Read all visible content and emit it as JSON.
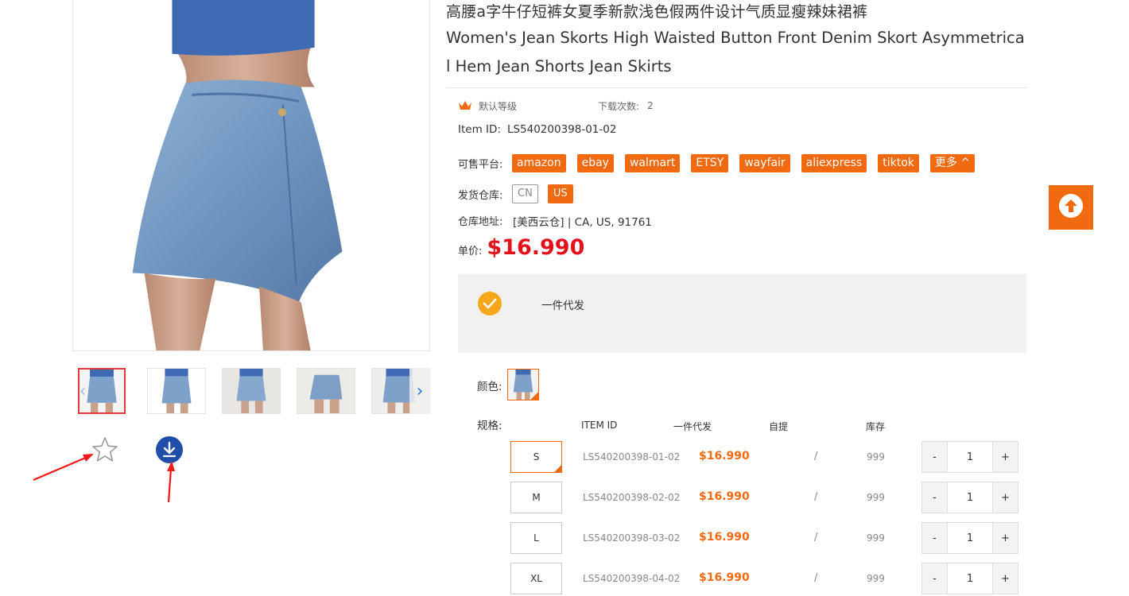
{
  "product": {
    "title_cn": "高腰a字牛仔短裤女夏季新款浅色假两件设计气质显瘦辣妹裙裤",
    "title_en": "Women's Jean Skorts High Waisted Button Front Denim Skort Asymmetrical Hem Jean Shorts Jean Skirts",
    "level": "默认等级",
    "download_count_label": "下载次数:",
    "download_count": "2",
    "item_id_label": "Item ID:",
    "item_id": "LS540200398-01-02",
    "platforms_label": "可售平台:",
    "platforms": [
      "amazon",
      "ebay",
      "walmart",
      "ETSY",
      "wayfair",
      "aliexpress",
      "tiktok"
    ],
    "more_label": "更多",
    "warehouse_label": "发货仓库:",
    "warehouses": [
      "CN",
      "US"
    ],
    "address_label": "仓库地址:",
    "address": "[美西云仓] | CA, US, 91761",
    "price_label": "单价:",
    "price": "$16.990",
    "ship_option": "一件代发",
    "color_label": "颜色:",
    "spec_label": "规格:"
  },
  "table": {
    "headers": {
      "item_id": "ITEM ID",
      "dropship": "一件代发",
      "pickup": "自提",
      "stock": "库存"
    },
    "rows": [
      {
        "size": "S",
        "sku": "LS540200398-01-02",
        "price": "$16.990",
        "pickup": "/",
        "stock": "999",
        "qty": "1"
      },
      {
        "size": "M",
        "sku": "LS540200398-02-02",
        "price": "$16.990",
        "pickup": "/",
        "stock": "999",
        "qty": "1"
      },
      {
        "size": "L",
        "sku": "LS540200398-03-02",
        "price": "$16.990",
        "pickup": "/",
        "stock": "999",
        "qty": "1"
      },
      {
        "size": "XL",
        "sku": "LS540200398-04-02",
        "price": "$16.990",
        "pickup": "/",
        "stock": "999",
        "qty": "1"
      }
    ],
    "minus": "-",
    "plus": "+"
  },
  "icons": {
    "favorite": "star-icon",
    "download": "download-icon",
    "back_to_top": "arrow-up-icon",
    "level": "crown-icon",
    "check": "check-icon"
  },
  "colors": {
    "accent": "#f26a10",
    "price": "#e4101b",
    "download": "#1f4fa8"
  }
}
